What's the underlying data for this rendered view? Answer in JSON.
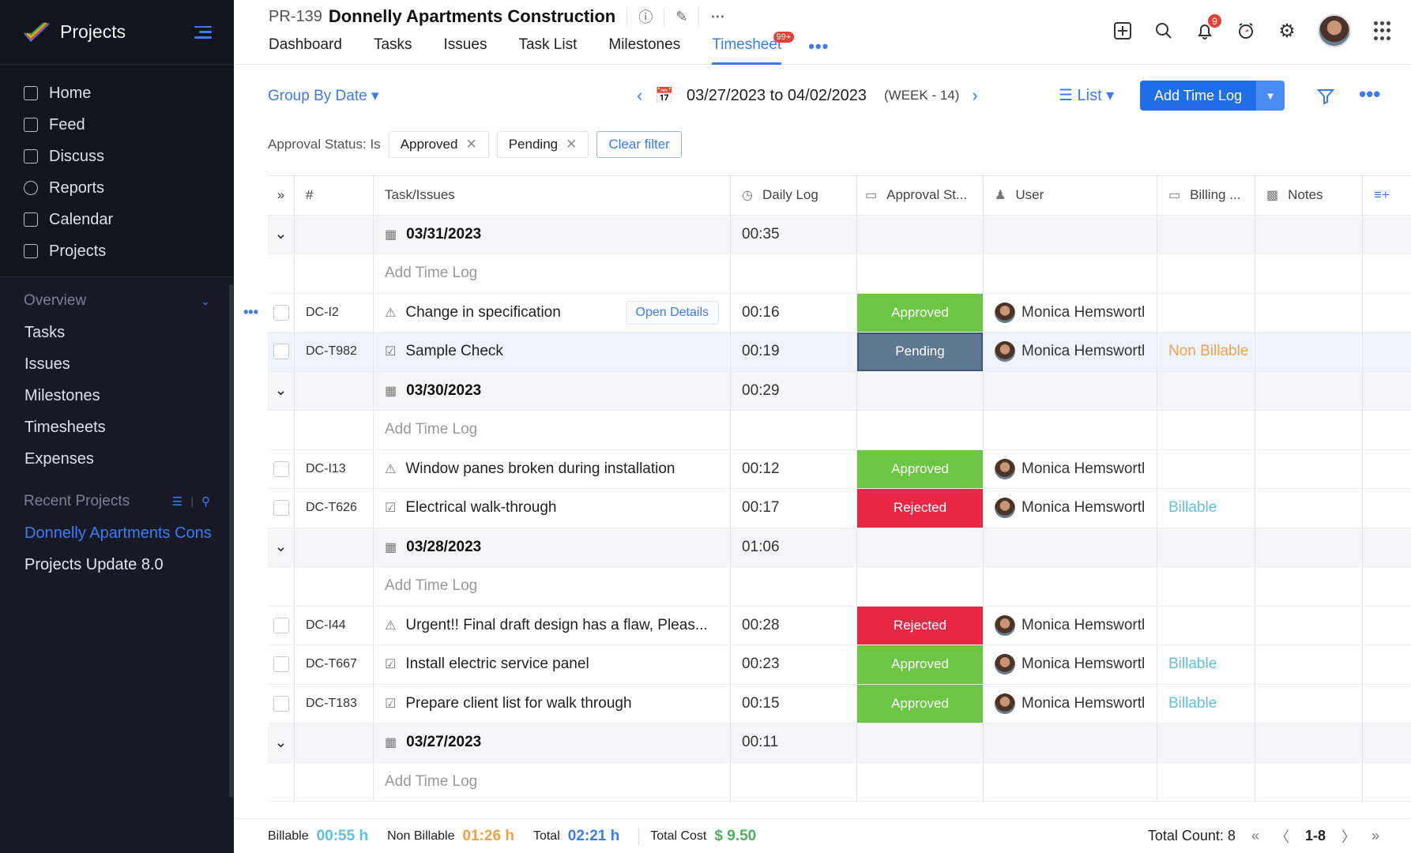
{
  "sidebar": {
    "app_title": "Projects",
    "nav": [
      {
        "label": "Home",
        "icon": "home-icon"
      },
      {
        "label": "Feed",
        "icon": "feed-icon"
      },
      {
        "label": "Discuss",
        "icon": "discuss-icon"
      },
      {
        "label": "Reports",
        "icon": "reports-icon"
      },
      {
        "label": "Calendar",
        "icon": "calendar-icon"
      },
      {
        "label": "Projects",
        "icon": "projects-icon"
      }
    ],
    "overview_label": "Overview",
    "overview_items": [
      "Tasks",
      "Issues",
      "Milestones",
      "Timesheets",
      "Expenses"
    ],
    "recent_label": "Recent Projects",
    "recent_projects": [
      "Donnelly Apartments Cons",
      "Projects Update 8.0"
    ]
  },
  "header": {
    "project_id": "PR-139",
    "project_name": "Donnelly Apartments Construction",
    "tabs": [
      "Dashboard",
      "Tasks",
      "Issues",
      "Task List",
      "Milestones",
      "Timesheet"
    ],
    "active_tab": "Timesheet",
    "timesheet_badge": "99+",
    "notification_count": "9"
  },
  "toolbar": {
    "group_by": "Group By Date",
    "date_range": "03/27/2023 to 04/02/2023",
    "week": "(WEEK - 14)",
    "view": "List",
    "add_time_log": "Add Time Log"
  },
  "filters": {
    "label": "Approval Status: Is",
    "chips": [
      "Approved",
      "Pending"
    ],
    "clear": "Clear filter"
  },
  "table": {
    "columns": [
      "#",
      "Task/Issues",
      "Daily Log",
      "Approval St...",
      "User",
      "Billing ...",
      "Notes"
    ],
    "add_time_log": "Add Time Log",
    "open_details": "Open Details",
    "groups": [
      {
        "date": "03/31/2023",
        "total": "00:35",
        "rows": [
          {
            "id": "DC-I2",
            "type": "issue",
            "title": "Change in specification",
            "log": "00:16",
            "status": "Approved",
            "user": "Monica Hemswortl",
            "billing": ""
          },
          {
            "id": "DC-T982",
            "type": "task",
            "title": "Sample Check",
            "log": "00:19",
            "status": "Pending",
            "user": "Monica Hemswortl",
            "billing": "Non Billable"
          }
        ]
      },
      {
        "date": "03/30/2023",
        "total": "00:29",
        "rows": [
          {
            "id": "DC-I13",
            "type": "issue",
            "title": "Window panes broken during installation",
            "log": "00:12",
            "status": "Approved",
            "user": "Monica Hemswortl",
            "billing": ""
          },
          {
            "id": "DC-T626",
            "type": "task",
            "title": "Electrical walk-through",
            "log": "00:17",
            "status": "Rejected",
            "user": "Monica Hemswortl",
            "billing": "Billable"
          }
        ]
      },
      {
        "date": "03/28/2023",
        "total": "01:06",
        "rows": [
          {
            "id": "DC-I44",
            "type": "issue",
            "title": "Urgent!! Final draft design has a flaw, Pleas...",
            "log": "00:28",
            "status": "Rejected",
            "user": "Monica Hemswortl",
            "billing": ""
          },
          {
            "id": "DC-T667",
            "type": "task",
            "title": "Install electric service panel",
            "log": "00:23",
            "status": "Approved",
            "user": "Monica Hemswortl",
            "billing": "Billable"
          },
          {
            "id": "DC-T183",
            "type": "task",
            "title": "Prepare client list for walk through",
            "log": "00:15",
            "status": "Approved",
            "user": "Monica Hemswortl",
            "billing": "Billable"
          }
        ]
      },
      {
        "date": "03/27/2023",
        "total": "00:11",
        "rows": []
      }
    ]
  },
  "footer": {
    "billable_label": "Billable",
    "billable": "00:55 h",
    "non_billable_label": "Non Billable",
    "non_billable": "01:26 h",
    "total_label": "Total",
    "total": "02:21 h",
    "cost_label": "Total Cost",
    "cost": "$ 9.50",
    "count": "Total Count: 8",
    "range": "1-8"
  }
}
